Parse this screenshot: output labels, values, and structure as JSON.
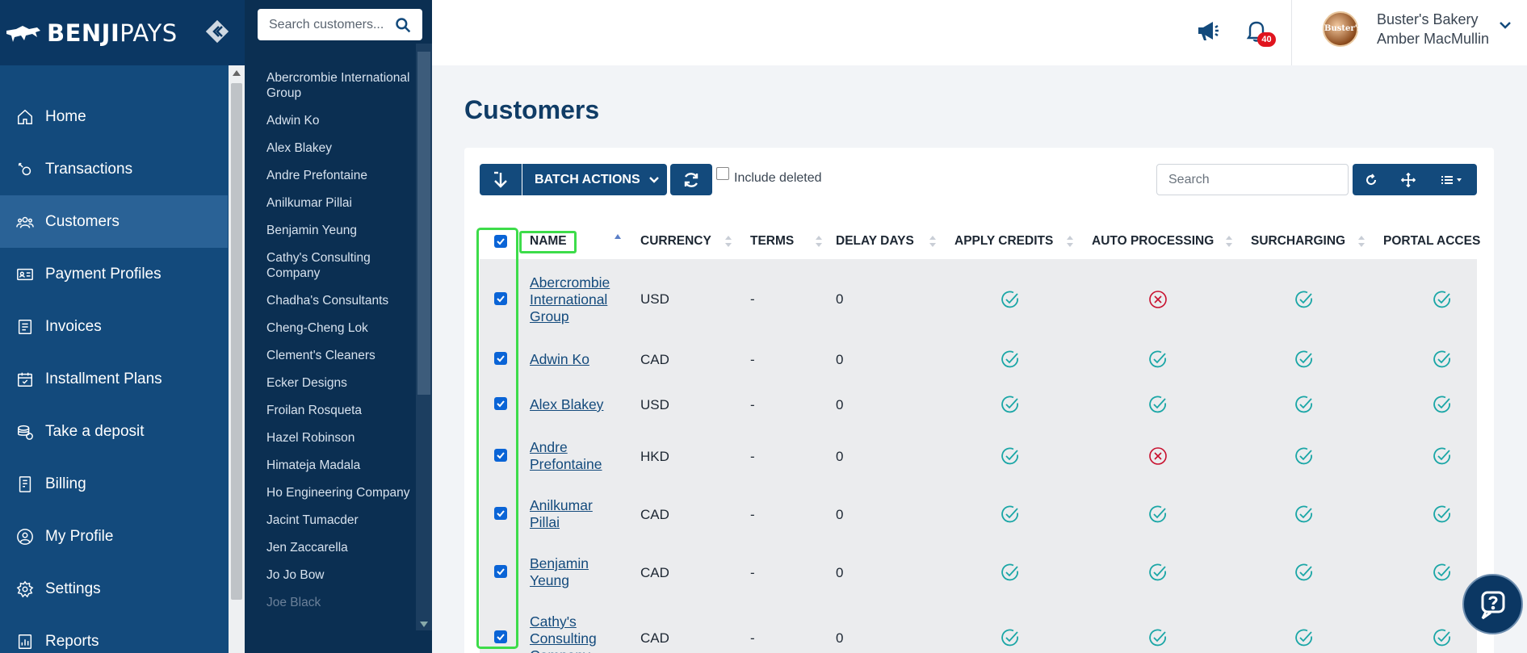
{
  "brand": {
    "name_bold": "BENJI",
    "name_light": "PAYS"
  },
  "nav": {
    "items": [
      {
        "label": "Home",
        "icon": "home-icon",
        "active": false
      },
      {
        "label": "Transactions",
        "icon": "transactions-icon",
        "active": false
      },
      {
        "label": "Customers",
        "icon": "customers-icon",
        "active": true
      },
      {
        "label": "Payment Profiles",
        "icon": "payment-profiles-icon",
        "active": false
      },
      {
        "label": "Invoices",
        "icon": "invoices-icon",
        "active": false
      },
      {
        "label": "Installment Plans",
        "icon": "calendar-icon",
        "active": false
      },
      {
        "label": "Take a deposit",
        "icon": "deposit-icon",
        "active": false
      },
      {
        "label": "Billing",
        "icon": "billing-icon",
        "active": false
      },
      {
        "label": "My Profile",
        "icon": "profile-icon",
        "active": false
      },
      {
        "label": "Settings",
        "icon": "gear-icon",
        "active": false
      },
      {
        "label": "Reports",
        "icon": "reports-icon",
        "active": false
      }
    ]
  },
  "customer_panel": {
    "search_placeholder": "Search customers...",
    "items": [
      "Abercrombie International Group",
      "Adwin Ko",
      "Alex Blakey",
      "Andre Prefontaine",
      "Anilkumar Pillai",
      "Benjamin Yeung",
      "Cathy's Consulting Company",
      "Chadha's Consultants",
      "Cheng-Cheng Lok",
      "Clement's Cleaners",
      "Ecker Designs",
      "Froilan Rosqueta",
      "Hazel Robinson",
      "Himateja Madala",
      "Ho Engineering Company",
      "Jacint Tumacder",
      "Jen Zaccarella",
      "Jo Jo Bow",
      "Joe Black"
    ]
  },
  "header": {
    "notification_count": "40",
    "business_name": "Buster's Bakery",
    "user_name": "Amber MacMullin",
    "avatar_text": "Buster's"
  },
  "page": {
    "title": "Customers",
    "batch_actions_label": "BATCH ACTIONS",
    "include_deleted_label": "Include deleted",
    "search_placeholder": "Search"
  },
  "table": {
    "columns": [
      "NAME",
      "CURRENCY",
      "TERMS",
      "DELAY DAYS",
      "APPLY CREDITS",
      "AUTO PROCESSING",
      "SURCHARGING",
      "PORTAL ACCES"
    ],
    "rows": [
      {
        "name": "Abercrombie International Group",
        "currency": "USD",
        "terms": "-",
        "delay_days": "0",
        "apply_credits": true,
        "auto_processing": false,
        "surcharging": true,
        "portal_access": true
      },
      {
        "name": "Adwin Ko",
        "currency": "CAD",
        "terms": "-",
        "delay_days": "0",
        "apply_credits": true,
        "auto_processing": true,
        "surcharging": true,
        "portal_access": true
      },
      {
        "name": "Alex Blakey",
        "currency": "USD",
        "terms": "-",
        "delay_days": "0",
        "apply_credits": true,
        "auto_processing": true,
        "surcharging": true,
        "portal_access": true
      },
      {
        "name": "Andre Prefontaine",
        "currency": "HKD",
        "terms": "-",
        "delay_days": "0",
        "apply_credits": true,
        "auto_processing": false,
        "surcharging": true,
        "portal_access": true
      },
      {
        "name": "Anilkumar Pillai",
        "currency": "CAD",
        "terms": "-",
        "delay_days": "0",
        "apply_credits": true,
        "auto_processing": true,
        "surcharging": true,
        "portal_access": true
      },
      {
        "name": "Benjamin Yeung",
        "currency": "CAD",
        "terms": "-",
        "delay_days": "0",
        "apply_credits": true,
        "auto_processing": true,
        "surcharging": true,
        "portal_access": true
      },
      {
        "name": "Cathy's Consulting Company",
        "currency": "CAD",
        "terms": "-",
        "delay_days": "0",
        "apply_credits": true,
        "auto_processing": true,
        "surcharging": true,
        "portal_access": true
      }
    ]
  },
  "colors": {
    "nav_bg": "#134a7c",
    "nav_top_bg": "#0b3763",
    "panel_bg": "#0b2f52",
    "accent": "#134a7c",
    "ok": "#1aa6a6",
    "error": "#c8102e",
    "highlight": "#3ddc4a"
  }
}
